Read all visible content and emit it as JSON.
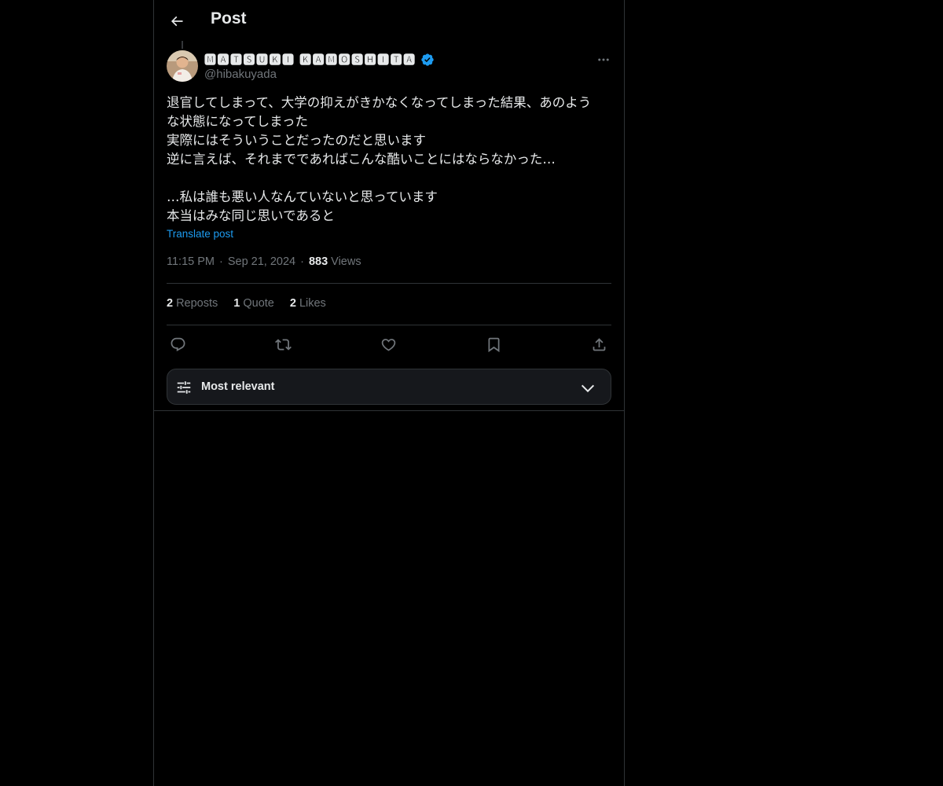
{
  "header": {
    "title": "Post",
    "back_icon": "arrow-left-icon"
  },
  "post": {
    "author": {
      "display_name": "🅼🅰🆃🆂🆄🅺🅸 🅺🅰🅼🅾🆂🅷🅸🆃🅰",
      "handle": "@hibakuyada",
      "verified": true
    },
    "text_lines": [
      "退官してしまって、大学の抑えがきかなくなってしまった結果、あのよう",
      "な状態になってしまった",
      "実際にはそういうことだったのだと思います",
      "逆に言えば、それまでであればこんな酷いことにはならなかった…",
      "",
      "…私は誰も悪い人なんていないと思っています",
      "本当はみな同じ思いであると"
    ],
    "translate_label": "Translate post",
    "time": "11:15 PM",
    "date": "Sep 21, 2024",
    "views_count": "883",
    "views_label": "Views",
    "separator": "·"
  },
  "stats": {
    "reposts_count": "2",
    "reposts_label": "Reposts",
    "quotes_count": "1",
    "quotes_label": "Quote",
    "likes_count": "2",
    "likes_label": "Likes"
  },
  "actions": [
    "reply-icon",
    "repost-icon",
    "like-icon",
    "bookmark-icon",
    "share-icon"
  ],
  "sort": {
    "label": "Most relevant",
    "icon": "sliders-icon"
  },
  "colors": {
    "background": "#000000",
    "text": "#e7e9ea",
    "secondary": "#71767b",
    "accent": "#1d9bf0",
    "border": "#2f3336"
  }
}
